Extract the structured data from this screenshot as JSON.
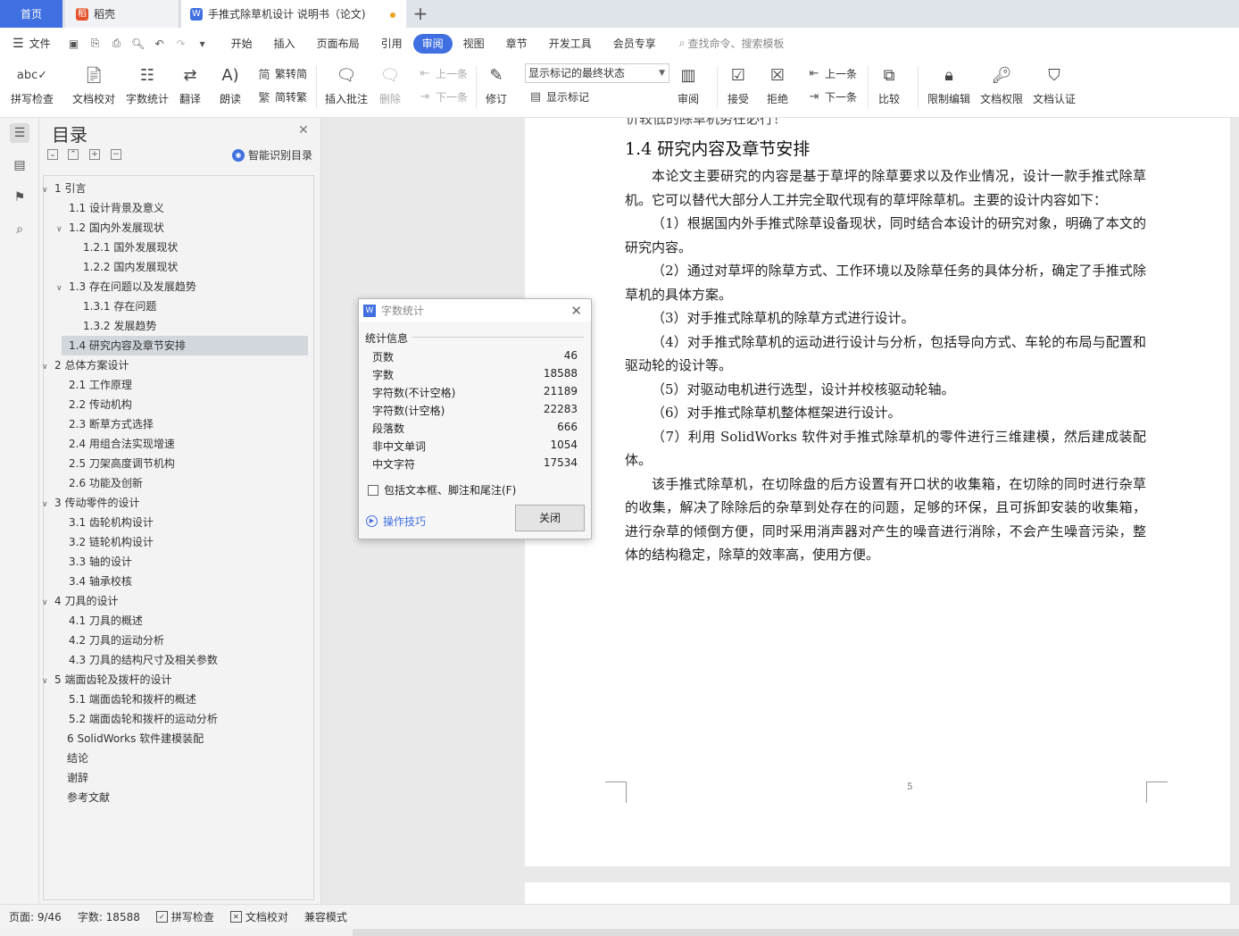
{
  "tabs": {
    "home": "首页",
    "daoke": "稻壳",
    "document": "手推式除草机设计 说明书（论文)"
  },
  "menu": {
    "file": "文件",
    "tabs": [
      "开始",
      "插入",
      "页面布局",
      "引用",
      "审阅",
      "视图",
      "章节",
      "开发工具",
      "会员专享"
    ],
    "active": "审阅",
    "search": "查找命令、搜索模板"
  },
  "ribbon": {
    "spellcheck": "拼写检查",
    "doccheck": "文档校对",
    "wordcount": "字数统计",
    "translate": "翻译",
    "read": "朗读",
    "trad": "繁转简",
    "simp": "简转繁",
    "insert_comment": "插入批注",
    "delete": "删除",
    "prev_comment": "上一条",
    "next_comment": "下一条",
    "track": "修订",
    "markup_state": "显示标记的最终状态",
    "show_markup": "显示标记",
    "review": "审阅",
    "accept": "接受",
    "reject": "拒绝",
    "prev_change": "上一条",
    "next_change": "下一条",
    "compare": "比较",
    "restrict": "限制编辑",
    "permission": "文档权限",
    "certify": "文档认证"
  },
  "toc": {
    "title": "目录",
    "smart": "智能识别目录",
    "items": [
      {
        "label": "1 引言",
        "level": 1,
        "expanded": true
      },
      {
        "label": "1.1 设计背景及意义",
        "level": 2
      },
      {
        "label": "1.2 国内外发展现状",
        "level": 2,
        "expanded": true
      },
      {
        "label": "1.2.1 国外发展现状",
        "level": 3
      },
      {
        "label": "1.2.2 国内发展现状",
        "level": 3
      },
      {
        "label": "1.3 存在问题以及发展趋势",
        "level": 2,
        "expanded": true
      },
      {
        "label": "1.3.1 存在问题",
        "level": 3
      },
      {
        "label": "1.3.2 发展趋势",
        "level": 3
      },
      {
        "label": "1.4 研究内容及章节安排",
        "level": 2,
        "selected": true
      },
      {
        "label": "2 总体方案设计",
        "level": 1,
        "expanded": true
      },
      {
        "label": "2.1 工作原理",
        "level": 2
      },
      {
        "label": "2.2 传动机构",
        "level": 2
      },
      {
        "label": "2.3 断草方式选择",
        "level": 2
      },
      {
        "label": "2.4 用组合法实现增速",
        "level": 2
      },
      {
        "label": "2.5 刀架高度调节机构",
        "level": 2
      },
      {
        "label": "2.6 功能及创新",
        "level": 2
      },
      {
        "label": "3 传动零件的设计",
        "level": 1,
        "expanded": true
      },
      {
        "label": "3.1 齿轮机构设计",
        "level": 2
      },
      {
        "label": "3.2 链轮机构设计",
        "level": 2
      },
      {
        "label": "3.3 轴的设计",
        "level": 2
      },
      {
        "label": "3.4 轴承校核",
        "level": 2
      },
      {
        "label": "4 刀具的设计",
        "level": 1,
        "expanded": true
      },
      {
        "label": "4.1  刀具的概述",
        "level": 2
      },
      {
        "label": "4.2 刀具的运动分析",
        "level": 2
      },
      {
        "label": "4.3 刀具的结构尺寸及相关参数",
        "level": 2
      },
      {
        "label": "5 端面齿轮及拨杆的设计",
        "level": 1,
        "expanded": true
      },
      {
        "label": "5.1 端面齿轮和拨杆的概述",
        "level": 2
      },
      {
        "label": "5.2  端面齿轮和拨杆的运动分析",
        "level": 2
      },
      {
        "label": "6 SolidWorks 软件建模装配",
        "level": 1
      },
      {
        "label": "结论",
        "level": 1
      },
      {
        "label": "谢辞",
        "level": 1
      },
      {
        "label": "参考文献",
        "level": 1
      }
    ]
  },
  "document": {
    "truncated_line": "价较低的除草机势在必行！",
    "section_title": "1.4 研究内容及章节安排",
    "paragraphs": [
      "本论文主要研究的内容是基于草坪的除草要求以及作业情况，设计一款手推式除草机。它可以替代大部分人工并完全取代现有的草坪除草机。主要的设计内容如下：",
      "（1）根据国内外手推式除草设备现状，同时结合本设计的研究对象，明确了本文的研究内容。",
      "（2）通过对草坪的除草方式、工作环境以及除草任务的具体分析，确定了手推式除草机的具体方案。",
      "（3）对手推式除草机的除草方式进行设计。",
      "（4）对手推式除草机的运动进行设计与分析，包括导向方式、车轮的布局与配置和驱动轮的设计等。",
      "（5）对驱动电机进行选型，设计并校核驱动轮轴。",
      "（6）对手推式除草机整体框架进行设计。",
      "（7）利用 SolidWorks 软件对手推式除草机的零件进行三维建模，然后建成装配体。",
      "该手推式除草机，在切除盘的后方设置有开口状的收集箱，在切除的同时进行杂草的收集，解决了除除后的杂草到处存在的问题，足够的环保，且可拆卸安装的收集箱，进行杂草的倾倒方便，同时采用消声器对产生的噪音进行消除，不会产生噪音污染，整体的结构稳定，除草的效率高，使用方便。"
    ],
    "page_number": "5"
  },
  "dialog": {
    "title": "字数统计",
    "section": "统计信息",
    "stats": [
      {
        "label": "页数",
        "value": "46"
      },
      {
        "label": "字数",
        "value": "18588"
      },
      {
        "label": "字符数(不计空格)",
        "value": "21189"
      },
      {
        "label": "字符数(计空格)",
        "value": "22283"
      },
      {
        "label": "段落数",
        "value": "666"
      },
      {
        "label": "非中文单词",
        "value": "1054"
      },
      {
        "label": "中文字符",
        "value": "17534"
      }
    ],
    "checkbox": "包括文本框、脚注和尾注(F)",
    "tips": "操作技巧",
    "close": "关闭"
  },
  "status": {
    "page": "页面: 9/46",
    "words": "字数: 18588",
    "spell": "拼写检查",
    "check": "文档校对",
    "compat": "兼容模式"
  }
}
